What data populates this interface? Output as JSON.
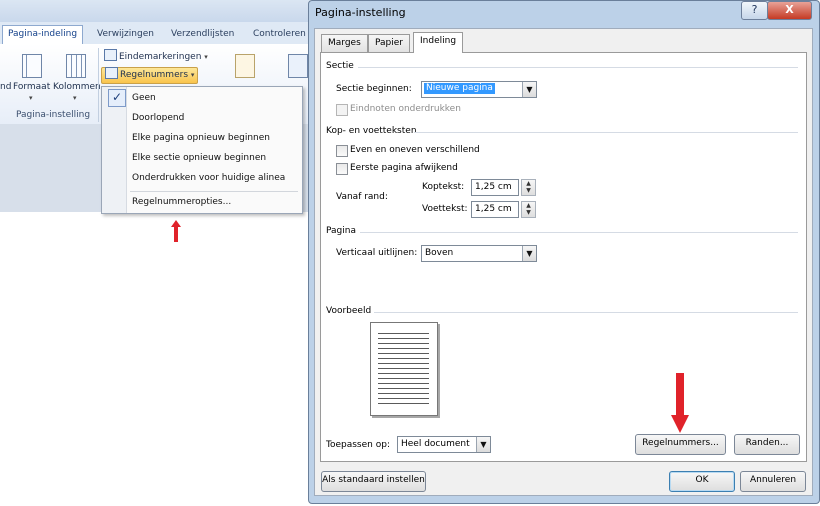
{
  "ribbon": {
    "tabs": [
      "Pagina-indeling",
      "Verwijzingen",
      "Verzendlijsten",
      "Controleren"
    ],
    "big_buttons": [
      "nd",
      "Formaat",
      "Kolommen"
    ],
    "eindemarkeringen_label": "Eindemarkeringen",
    "regelnummers_label": "Regelnummers",
    "group_label": "Pagina-instelling",
    "menu": {
      "items": [
        "Geen",
        "Doorlopend",
        "Elke pagina opnieuw beginnen",
        "Elke sectie opnieuw beginnen",
        "Onderdrukken voor huidige alinea",
        "Regelnummeropties..."
      ],
      "checked_index": 0
    }
  },
  "dialog": {
    "title": "Pagina-instelling",
    "help_glyph": "?",
    "close_glyph": "X",
    "tabs": [
      "Marges",
      "Papier",
      "Indeling"
    ],
    "active_tab": "Indeling",
    "sectie": {
      "heading": "Sectie",
      "sectie_beginnen_label": "Sectie beginnen:",
      "sectie_beginnen_value": "Nieuwe pagina",
      "eindnoten_label": "Eindnoten onderdrukken"
    },
    "kop": {
      "heading": "Kop- en voetteksten",
      "even_oneven_label": "Even en oneven verschillend",
      "eerste_pagina_label": "Eerste pagina afwijkend",
      "vanaf_rand_label": "Vanaf rand:",
      "koptekst_label": "Koptekst:",
      "koptekst_value": "1,25 cm",
      "voettekst_label": "Voettekst:",
      "voettekst_value": "1,25 cm"
    },
    "pagina": {
      "heading": "Pagina",
      "verticaal_label": "Verticaal uitlijnen:",
      "verticaal_value": "Boven"
    },
    "voorbeeld_heading": "Voorbeeld",
    "toepassen_label": "Toepassen op:",
    "toepassen_value": "Heel document",
    "regelnummers_button": "Regelnummers...",
    "randen_button": "Randen...",
    "standaard_button": "Als standaard instellen",
    "ok_button": "OK",
    "annuleren_button": "Annuleren"
  },
  "colors": {
    "annotation_arrow": "#e0222a",
    "menu_highlight": "#3399ff",
    "regelnummers_highlight": "#f9c44d"
  },
  "icons": [
    "check-icon",
    "dropdown-arrow-icon",
    "spin-up-icon",
    "spin-down-icon",
    "help-icon",
    "close-icon",
    "page-preview-icon",
    "annotation-arrow"
  ]
}
